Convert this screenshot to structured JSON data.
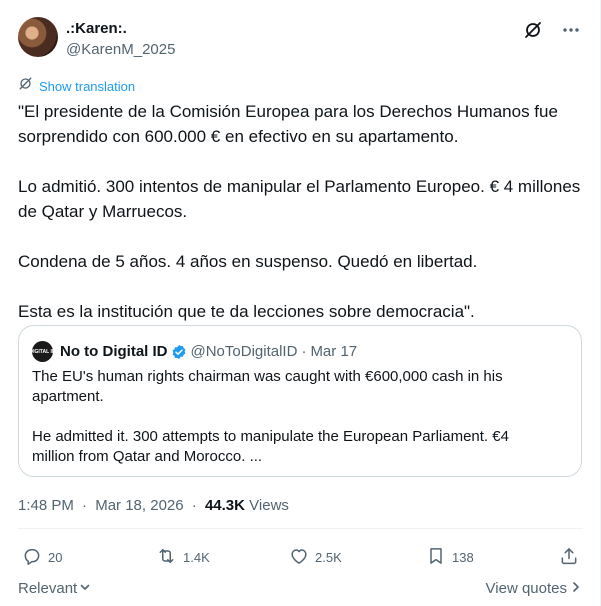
{
  "author": {
    "name": ".:Karen:.",
    "handle": "@KarenM_2025"
  },
  "translate": {
    "label": "Show translation"
  },
  "tweet": {
    "paragraphs": [
      "\"El presidente de la Comisión Europea para los Derechos Humanos fue sorprendido con 600.000 € en efectivo en su apartamento.",
      "Lo admitió. 300 intentos de manipular el Parlamento Europeo. € 4 millones de Qatar y Marruecos.",
      "Condena de 5 años. 4 años en suspenso. Quedó en libertad.",
      "Esta es la institución que te da lecciones sobre democracia\"."
    ]
  },
  "quote": {
    "avatar_text": "DIGITAL ID",
    "name": "No to Digital ID",
    "handle": "@NoToDigitalID",
    "separator": "·",
    "date": "Mar 17",
    "paragraphs": [
      "The EU's human rights chairman was caught with €600,000 cash in his apartment.",
      "He admitted it. 300 attempts to manipulate the European Parliament. €4 million from Qatar and Morocco. ..."
    ]
  },
  "meta": {
    "time": "1:48 PM",
    "sep": "·",
    "date": "Mar 18, 2026",
    "views_count": "44.3K",
    "views_label": "Views"
  },
  "actions": {
    "replies": "20",
    "reposts": "1.4K",
    "likes": "2.5K",
    "bookmarks": "138"
  },
  "footer": {
    "sort_label": "Relevant",
    "view_quotes": "View quotes"
  },
  "colors": {
    "accent": "#1d9bf0",
    "muted": "#536471",
    "text": "#0f1419",
    "border": "#cfd9de"
  }
}
